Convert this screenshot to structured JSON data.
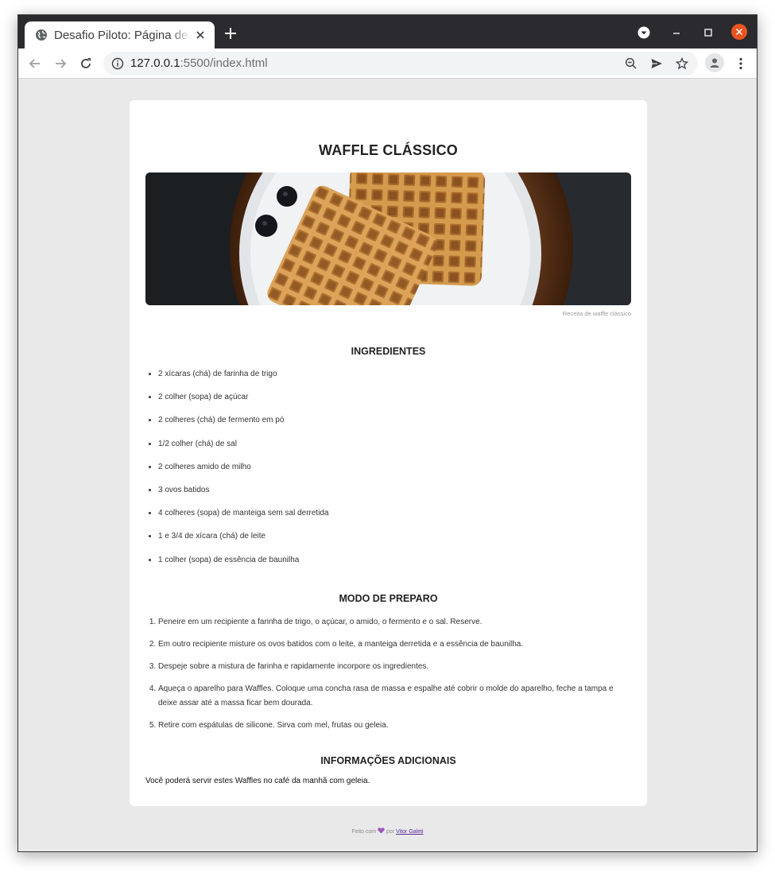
{
  "browser": {
    "tab_title": "Desafio Piloto: Página de Receita",
    "url_host": "127.0.0.1",
    "url_rest": ":5500/index.html",
    "close_button_color": "#e95420"
  },
  "page": {
    "title": "WAFFLE CLÁSSICO",
    "image_caption": "Receita de waffle clássico",
    "ingredients_heading": "INGREDIENTES",
    "ingredients": [
      "2 xícaras (chá) de farinha de trigo",
      "2 colher (sopa) de açúcar",
      "2 colheres (chá) de fermento em pó",
      "1/2 colher (chá) de sal",
      "2 colheres amido de milho",
      "3 ovos batidos",
      "4 colheres (sopa) de manteiga sem sal derretida",
      "1 e 3/4 de xícara (chá) de leite",
      "1 colher (sopa) de essência de baunilha"
    ],
    "method_heading": "MODO DE PREPARO",
    "method": [
      "Peneire em um recipiente a farinha de trigo, o açúcar, o amido, o fermento e o sal. Reserve.",
      "Em outro recipiente misture os ovos batidos com o leite, a manteiga derretida e a essência de baunilha.",
      "Despeje sobre a mistura de farinha e rapidamente incorpore os ingredientes.",
      "Aqueça o aparelho para Waffles. Coloque uma concha rasa de massa e espalhe até cobrir o molde do aparelho, feche a tampa e deixe assar até a massa ficar bem dourada.",
      "Retire com espátulas de silicone. Sirva com mel, frutas ou geleia."
    ],
    "info_heading": "INFORMAÇÕES ADICIONAIS",
    "info_text": "Você poderá servir estes Waffles no café da manhã com geleia."
  },
  "footer": {
    "made_with": "Feito com",
    "by": "por",
    "author": "Vitor Galeti",
    "heart_color": "#9b59b6"
  }
}
